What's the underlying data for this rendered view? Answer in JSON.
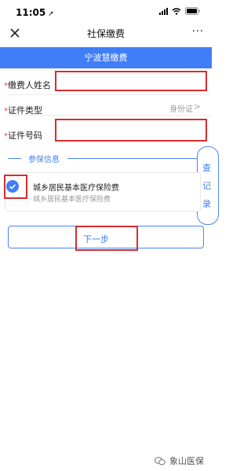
{
  "status_bar": {
    "time": "11:05",
    "location_glyph": "➚"
  },
  "nav": {
    "title": "社保缴费",
    "more": "···"
  },
  "banner": {
    "title": "宁波慧缴费"
  },
  "form": {
    "required_mark": "*",
    "payer_name_label": "缴费人姓名",
    "payer_name_value": "",
    "id_type_label": "证件类型",
    "id_type_value": "身份证",
    "id_number_label": "证件号码",
    "id_number_value": ""
  },
  "insurance_section": {
    "title": "参保信息",
    "items": [
      {
        "title": "城乡居民基本医疗保险费",
        "subtitle": "城乡居民基本医疗保险费",
        "checked": true
      }
    ]
  },
  "side_tab": {
    "chars": [
      "查",
      "记",
      "录"
    ]
  },
  "next_button": {
    "label": "下一步"
  },
  "watermark": {
    "text": "象山医保"
  },
  "colors": {
    "accent": "#3f7ef7",
    "highlight_box": "#d62d2d",
    "required": "#e94040"
  }
}
